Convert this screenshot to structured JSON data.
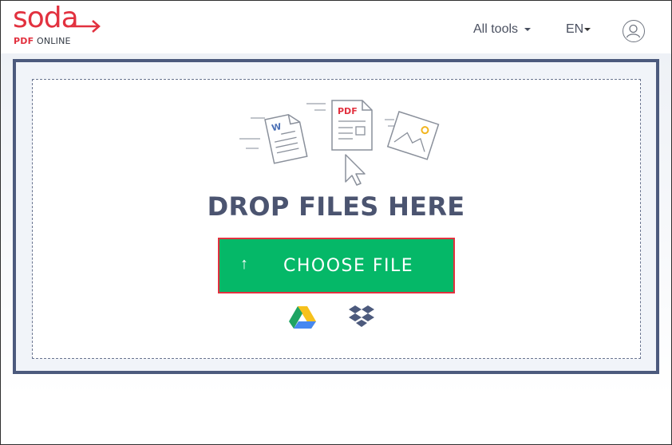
{
  "brand": {
    "name": "soda",
    "sub_bold": "PDF",
    "sub_rest": " ONLINE",
    "color": "#e2313f"
  },
  "nav": {
    "all_tools": "All tools",
    "language": "EN",
    "user_icon": "user-icon"
  },
  "dropzone": {
    "title": "DROP FILES HERE",
    "illustration_labels": {
      "word_letter": "W",
      "pdf_label": "PDF"
    }
  },
  "upload": {
    "button_icon": "↑",
    "button_label": "CHOOSE FILE",
    "button_color": "#05b868"
  },
  "cloud_sources": [
    {
      "name": "Google Drive",
      "icon": "google-drive-icon"
    },
    {
      "name": "Dropbox",
      "icon": "dropbox-icon"
    }
  ]
}
